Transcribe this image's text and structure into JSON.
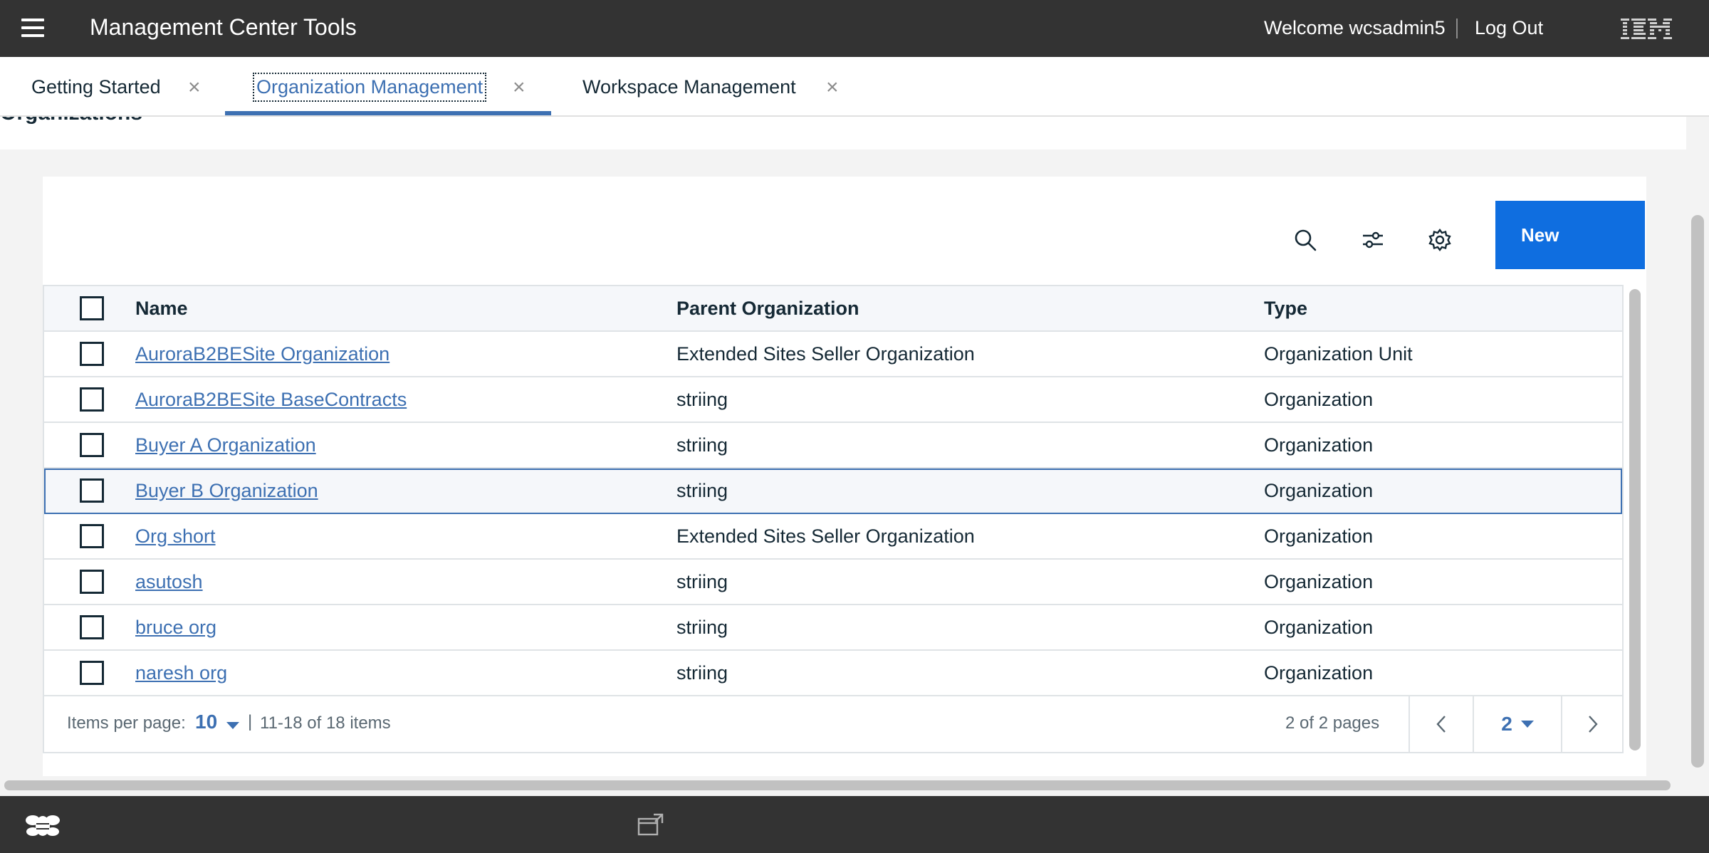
{
  "header": {
    "app_title": "Management Center Tools",
    "welcome": "Welcome wcsadmin5",
    "logout": "Log Out",
    "brand": "IBM"
  },
  "tabs": [
    {
      "label": "Getting Started",
      "active": false
    },
    {
      "label": "Organization Management",
      "active": true
    },
    {
      "label": "Workspace Management",
      "active": false
    }
  ],
  "page": {
    "title": "Organizations"
  },
  "toolbar": {
    "new_label": "New",
    "icons": [
      "search-icon",
      "filter-icon",
      "gear-icon"
    ]
  },
  "table": {
    "columns": [
      "Name",
      "Parent Organization",
      "Type"
    ],
    "rows": [
      {
        "name": "AuroraB2BESite Organization",
        "parent": "Extended Sites Seller Organization",
        "type": "Organization Unit"
      },
      {
        "name": "AuroraB2BESite BaseContracts",
        "parent": "striing",
        "type": "Organization"
      },
      {
        "name": "Buyer A Organization",
        "parent": "striing",
        "type": "Organization"
      },
      {
        "name": "Buyer B Organization",
        "parent": "striing",
        "type": "Organization"
      },
      {
        "name": "Org short",
        "parent": "Extended Sites Seller Organization",
        "type": "Organization"
      },
      {
        "name": "asutosh",
        "parent": "striing",
        "type": "Organization"
      },
      {
        "name": "bruce org",
        "parent": "striing",
        "type": "Organization"
      },
      {
        "name": "naresh org",
        "parent": "striing",
        "type": "Organization"
      }
    ]
  },
  "pagination": {
    "items_per_page_label": "Items per page:",
    "items_per_page": "10",
    "separator": "|",
    "range": "11-18 of 18 items",
    "pages": "2 of 2 pages",
    "current_page": "2"
  },
  "colors": {
    "header_bg": "#333333",
    "accent": "#3d70b2",
    "primary_button": "#0f6ee0"
  }
}
